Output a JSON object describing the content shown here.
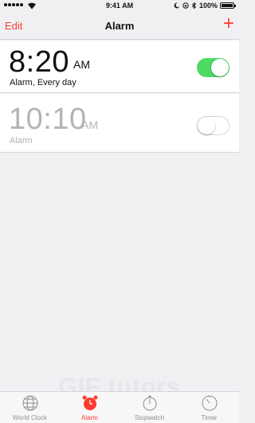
{
  "status_bar": {
    "time": "9:41 AM",
    "battery": "100%"
  },
  "nav": {
    "edit_label": "Edit",
    "title": "Alarm",
    "add_label": "+"
  },
  "alarms": [
    {
      "time": "8:20",
      "ampm": "AM",
      "label": "Alarm, Every day",
      "enabled": true
    },
    {
      "time": "10:10",
      "ampm": "AM",
      "label": "Alarm",
      "enabled": false
    }
  ],
  "watermark": "GIF tutors",
  "tabs": [
    {
      "label": "World Clock",
      "icon": "globe-icon",
      "active": false
    },
    {
      "label": "Alarm",
      "icon": "alarm-clock-icon",
      "active": true
    },
    {
      "label": "Stopwatch",
      "icon": "stopwatch-icon",
      "active": false
    },
    {
      "label": "Timer",
      "icon": "timer-icon",
      "active": false
    }
  ],
  "colors": {
    "accent": "#ff3b30",
    "toggle_on": "#4cd964",
    "inactive_text": "#b4b4b8",
    "tab_inactive": "#8e8e93"
  }
}
